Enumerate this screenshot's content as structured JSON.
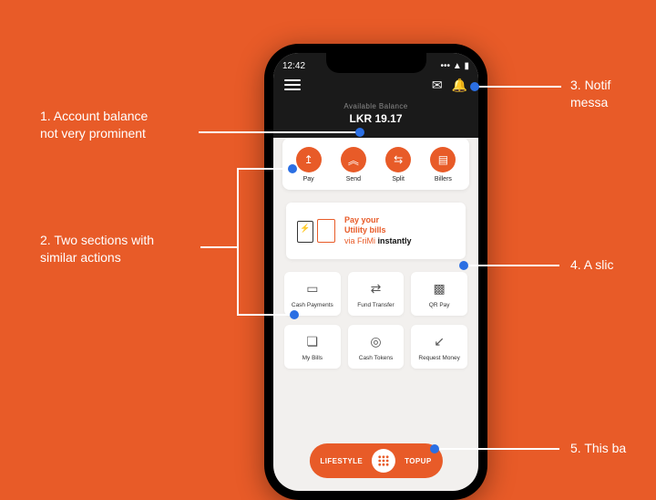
{
  "status": {
    "time": "12:42"
  },
  "balance": {
    "label": "Available Balance",
    "value": "LKR 19.17"
  },
  "actions": [
    {
      "icon": "↥",
      "label": "Pay"
    },
    {
      "icon": "︽",
      "label": "Send"
    },
    {
      "icon": "⇆",
      "label": "Split"
    },
    {
      "icon": "▤",
      "label": "Billers"
    }
  ],
  "promo": {
    "line1": "Pay your",
    "line2": "Utility bills",
    "line3_prefix": "via FriMi",
    "line3_bold": "instantly"
  },
  "grid_tiles": [
    {
      "icon": "▭",
      "label": "Cash Payments"
    },
    {
      "icon": "⇄",
      "label": "Fund Transfer"
    },
    {
      "icon": "▩",
      "label": "QR Pay"
    },
    {
      "icon": "❏",
      "label": "My Bills"
    },
    {
      "icon": "◎",
      "label": "Cash Tokens"
    },
    {
      "icon": "↙",
      "label": "Request Money"
    }
  ],
  "bottom": {
    "left": "LIFESTYLE",
    "right": "TOPUP"
  },
  "annotations": {
    "a1": "1. Account balance\nnot very prominent",
    "a2": "2. Two sections with\nsimilar actions",
    "a3": "3. Notif\nmessa",
    "a4": "4. A slic",
    "a5": "5. This ba"
  }
}
